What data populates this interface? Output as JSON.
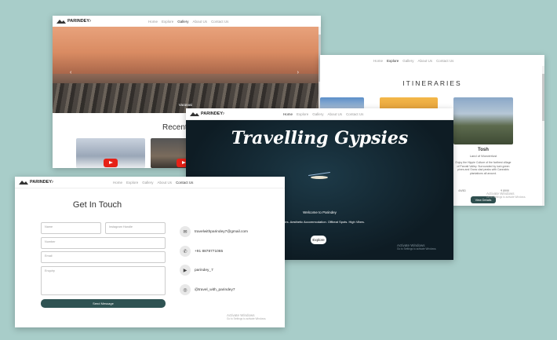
{
  "brand": "PARINDEY",
  "brand_sup": "7",
  "win_gallery": {
    "nav": [
      "Home",
      "Explore",
      "Gallery",
      "About Us",
      "Contact Us"
    ],
    "active": "Gallery",
    "caption": "Varanasi",
    "recent_heading": "Recent"
  },
  "win_itineraries": {
    "nav": [
      "Home",
      "Explore",
      "Gallery",
      "About Us",
      "Contact Us"
    ],
    "active": "Explore",
    "title": "ITINERARIES",
    "card_name": "Tosh",
    "card_sub": "Land of Wonderlust",
    "card_desc": "Enjoy the Hippie Culture of the farthest village of Parvati Valley. Surrounded by lush green pines and Snow clad peaks with Cannabis plantations all around.",
    "meta_left": "4N/5D",
    "meta_right": "₹ 8999",
    "button": "View Details",
    "activate_line1": "Activate Windows",
    "activate_line2": "Go to Settings to activate Windows."
  },
  "win_gypsies": {
    "nav": [
      "Home",
      "Explore",
      "Gallery",
      "About Us",
      "Contact Us"
    ],
    "active": "Home",
    "headline": "Travelling Gypsies",
    "welcome": "Welcome to Parindey",
    "tagline": "Itineraries. Aesthetic Accommodation. Offbeat Spots. High Vibes.",
    "explore": "Explore",
    "activate_line1": "Activate Windows",
    "activate_line2": "Go to Settings to activate Windows."
  },
  "win_contact": {
    "nav": [
      "Home",
      "Explore",
      "Gallery",
      "About Us",
      "Contact Us"
    ],
    "active": "Contact Us",
    "heading": "Get In Touch",
    "placeholders": {
      "name": "Name",
      "instagram": "Instagram Handle",
      "number": "Number",
      "email": "Email",
      "enquiry": "Enquiry"
    },
    "send": "Send Message",
    "contacts": [
      {
        "icon": "mail-icon",
        "text": "travelwithparindey7@gmail.com"
      },
      {
        "icon": "phone-icon",
        "text": "+91 8878771065"
      },
      {
        "icon": "youtube-icon",
        "text": "parindey_7"
      },
      {
        "icon": "instagram-icon",
        "text": "@travel_with_parindey7"
      }
    ],
    "activate_line1": "Activate Windows",
    "activate_line2": "Go to Settings to activate Windows."
  },
  "colors": {
    "background": "#a8cdc9",
    "accent": "#2f5353",
    "dark_bg": "#162a35"
  }
}
